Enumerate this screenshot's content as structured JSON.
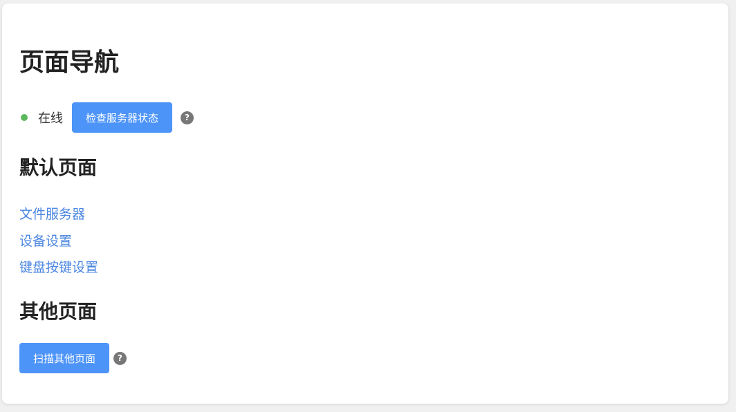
{
  "page": {
    "title": "页面导航"
  },
  "status": {
    "text": "在线",
    "dot_color": "#5cb85c",
    "check_button_label": "检查服务器状态",
    "help_glyph": "?"
  },
  "default_pages": {
    "heading": "默认页面",
    "links": [
      {
        "label": "文件服务器"
      },
      {
        "label": "设备设置"
      },
      {
        "label": "键盘按键设置"
      }
    ]
  },
  "other_pages": {
    "heading": "其他页面",
    "scan_button_label": "扫描其他页面",
    "help_glyph": "?"
  },
  "colors": {
    "button_bg": "#4d94f8",
    "link": "#4a86e0",
    "help_icon_bg": "#777777"
  },
  "icons": {
    "status": "status-dot-icon",
    "help": "question-circle-icon"
  }
}
